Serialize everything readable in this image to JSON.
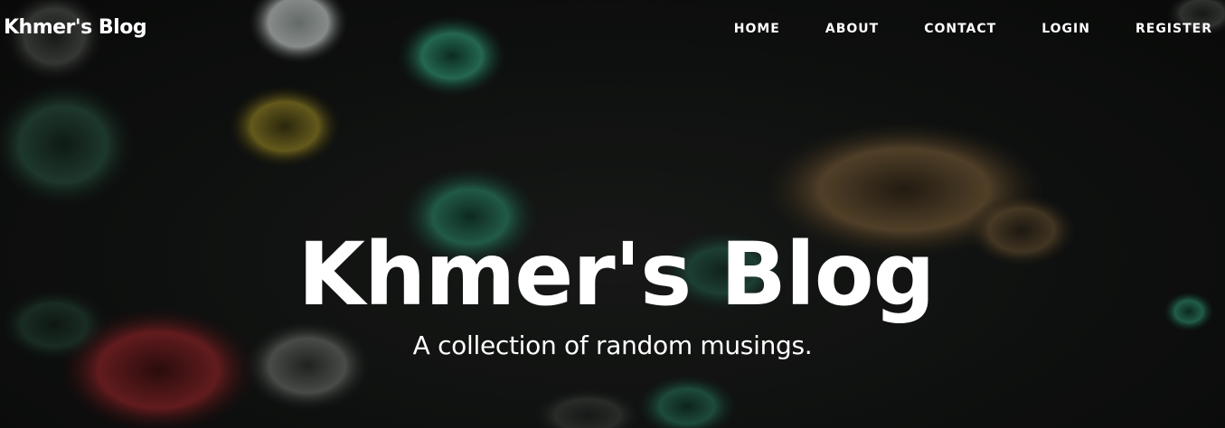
{
  "navbar": {
    "brand": "Khmer's Blog",
    "links": [
      {
        "label": "HOME"
      },
      {
        "label": "ABOUT"
      },
      {
        "label": "CONTACT"
      },
      {
        "label": "LOGIN"
      },
      {
        "label": "REGISTER"
      }
    ]
  },
  "header": {
    "title": "Khmer's Blog",
    "subheading": "A collection of random musings."
  },
  "colors": {
    "text": "#ffffff",
    "background": "#121413"
  }
}
